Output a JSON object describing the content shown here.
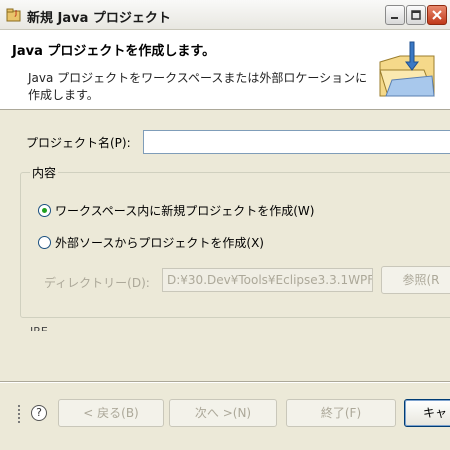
{
  "window": {
    "title": "新規 Java プロジェクト",
    "controls": [
      "minimize-icon",
      "maximize-icon",
      "close-icon"
    ]
  },
  "header": {
    "title": "Java プロジェクトを作成します。",
    "description": "Java プロジェクトをワークスペースまたは外部ロケーションに作成します。",
    "icon": "new-java-project-folder-icon"
  },
  "project": {
    "name_label": "プロジェクト名(P):",
    "name_value": ""
  },
  "contents": {
    "group_label": "内容",
    "option_workspace": "ワークスペース内に新規プロジェクトを作成(W)",
    "option_external": "外部ソースからプロジェクトを作成(X)",
    "selected": "workspace",
    "directory_label": "ディレクトリー(D):",
    "directory_value": "D:¥30.Dev¥Tools¥Eclipse3.3.1WPF",
    "browse_label": "参照(R"
  },
  "jre": {
    "label": "JRE"
  },
  "footer": {
    "help_icon": "help-icon",
    "back_label": "< 戻る(B)",
    "next_label": "次へ >(N)",
    "finish_label": "終了(F)",
    "cancel_label": "キャ"
  },
  "colors": {
    "window_bg": "#ece9d8",
    "banner_bg": "#ffffff",
    "disabled_text": "#aca899",
    "close_button": "#c0391a",
    "radio_dot": "#21a121"
  }
}
